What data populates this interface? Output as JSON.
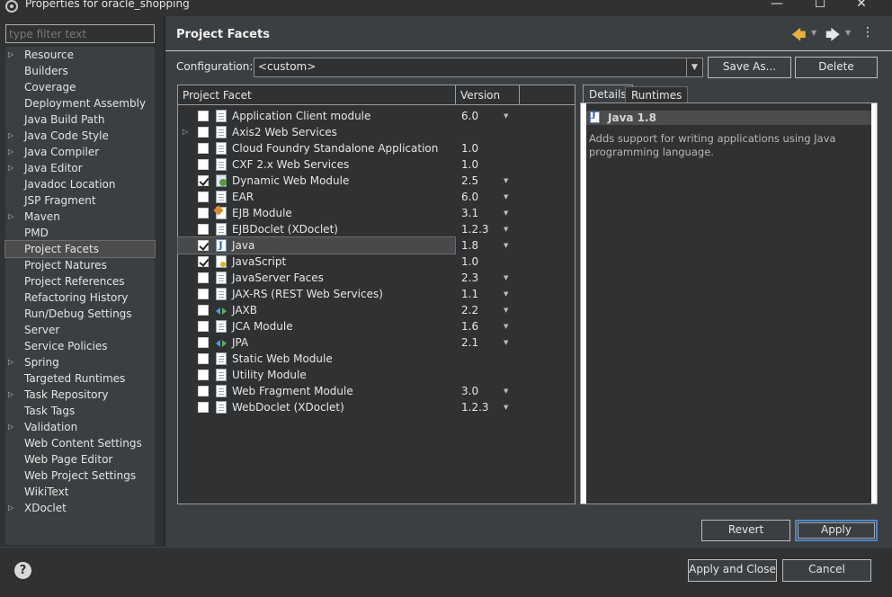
{
  "window": {
    "title": "Properties for oracle_shopping",
    "minimize": "—",
    "maximize": "☐",
    "close": "✕"
  },
  "sidebar": {
    "filter_placeholder": "type filter text",
    "items": [
      {
        "label": "Resource",
        "expandable": true
      },
      {
        "label": "Builders",
        "expandable": false
      },
      {
        "label": "Coverage",
        "expandable": false
      },
      {
        "label": "Deployment Assembly",
        "expandable": false
      },
      {
        "label": "Java Build Path",
        "expandable": false
      },
      {
        "label": "Java Code Style",
        "expandable": true
      },
      {
        "label": "Java Compiler",
        "expandable": true
      },
      {
        "label": "Java Editor",
        "expandable": true
      },
      {
        "label": "Javadoc Location",
        "expandable": false
      },
      {
        "label": "JSP Fragment",
        "expandable": false
      },
      {
        "label": "Maven",
        "expandable": true
      },
      {
        "label": "PMD",
        "expandable": false
      },
      {
        "label": "Project Facets",
        "expandable": false,
        "selected": true
      },
      {
        "label": "Project Natures",
        "expandable": false
      },
      {
        "label": "Project References",
        "expandable": false
      },
      {
        "label": "Refactoring History",
        "expandable": false
      },
      {
        "label": "Run/Debug Settings",
        "expandable": false
      },
      {
        "label": "Server",
        "expandable": false
      },
      {
        "label": "Service Policies",
        "expandable": false
      },
      {
        "label": "Spring",
        "expandable": true
      },
      {
        "label": "Targeted Runtimes",
        "expandable": false
      },
      {
        "label": "Task Repository",
        "expandable": true
      },
      {
        "label": "Task Tags",
        "expandable": false
      },
      {
        "label": "Validation",
        "expandable": true
      },
      {
        "label": "Web Content Settings",
        "expandable": false
      },
      {
        "label": "Web Page Editor",
        "expandable": false
      },
      {
        "label": "Web Project Settings",
        "expandable": false
      },
      {
        "label": "WikiText",
        "expandable": false
      },
      {
        "label": "XDoclet",
        "expandable": true
      }
    ]
  },
  "header": {
    "title": "Project Facets",
    "back_icon": "arrow-left-icon",
    "forward_icon": "arrow-right-icon",
    "menu_icon": "vertical-ellipsis-icon"
  },
  "configuration": {
    "label": "Configuration:",
    "value": "<custom>",
    "save_as_label": "Save As...",
    "delete_label": "Delete"
  },
  "facets": {
    "columns": [
      "Project Facet",
      "Version"
    ],
    "rows": [
      {
        "name": "Application Client module",
        "version": "6.0",
        "checked": false,
        "icon": "doc",
        "has_dropdown": true
      },
      {
        "name": "Axis2 Web Services",
        "version": "",
        "checked": false,
        "icon": "doc",
        "expander": true
      },
      {
        "name": "Cloud Foundry Standalone Application",
        "version": "1.0",
        "checked": false,
        "icon": "doc"
      },
      {
        "name": "CXF 2.x Web Services",
        "version": "1.0",
        "checked": false,
        "icon": "doc"
      },
      {
        "name": "Dynamic Web Module",
        "version": "2.5",
        "checked": true,
        "icon": "globe",
        "has_dropdown": true
      },
      {
        "name": "EAR",
        "version": "6.0",
        "checked": false,
        "icon": "doc",
        "has_dropdown": true
      },
      {
        "name": "EJB Module",
        "version": "3.1",
        "checked": false,
        "icon": "ejb",
        "has_dropdown": true
      },
      {
        "name": "EJBDoclet (XDoclet)",
        "version": "1.2.3",
        "checked": false,
        "icon": "doc",
        "has_dropdown": true
      },
      {
        "name": "Java",
        "version": "1.8",
        "checked": true,
        "icon": "jcode",
        "has_dropdown": true,
        "selected": true
      },
      {
        "name": "JavaScript",
        "version": "1.0",
        "checked": true,
        "icon": "js"
      },
      {
        "name": "JavaServer Faces",
        "version": "2.3",
        "checked": false,
        "icon": "doc",
        "has_dropdown": true
      },
      {
        "name": "JAX-RS (REST Web Services)",
        "version": "1.1",
        "checked": false,
        "icon": "doc",
        "has_dropdown": true
      },
      {
        "name": "JAXB",
        "version": "2.2",
        "checked": false,
        "icon": "arrows",
        "has_dropdown": true
      },
      {
        "name": "JCA Module",
        "version": "1.6",
        "checked": false,
        "icon": "doc",
        "has_dropdown": true
      },
      {
        "name": "JPA",
        "version": "2.1",
        "checked": false,
        "icon": "arrows",
        "has_dropdown": true
      },
      {
        "name": "Static Web Module",
        "version": "",
        "checked": false,
        "icon": "doc"
      },
      {
        "name": "Utility Module",
        "version": "",
        "checked": false,
        "icon": "doc"
      },
      {
        "name": "Web Fragment Module",
        "version": "3.0",
        "checked": false,
        "icon": "doc",
        "has_dropdown": true
      },
      {
        "name": "WebDoclet (XDoclet)",
        "version": "1.2.3",
        "checked": false,
        "icon": "doc",
        "has_dropdown": true
      }
    ]
  },
  "details": {
    "tabs": [
      "Details",
      "Runtimes"
    ],
    "active_tab": "Details",
    "title": "Java 1.8",
    "description": "Adds support for writing applications using Java programming language."
  },
  "actions": {
    "revert_label": "Revert",
    "apply_label": "Apply",
    "apply_close_label": "Apply and Close",
    "cancel_label": "Cancel"
  },
  "colors": {
    "background": "#2f3133",
    "panel": "#3c3f41",
    "accent": "#4d86c9",
    "back_arrow": "#e7b13a"
  }
}
